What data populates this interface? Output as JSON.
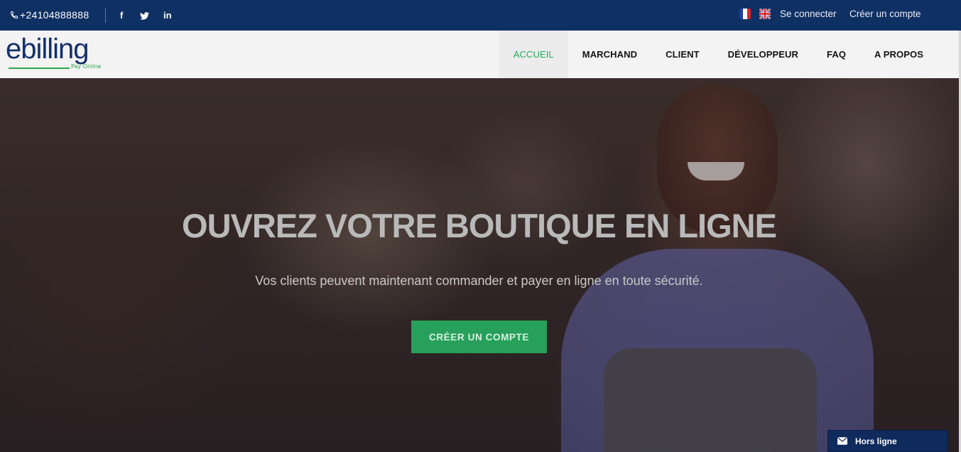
{
  "topbar": {
    "phone": "+24104888888",
    "social": {
      "facebook": "f",
      "twitter": "twitter-icon",
      "linkedin": "in"
    },
    "languages": [
      "fr",
      "en"
    ],
    "login_label": "Se connecter",
    "register_label": "Créer un compte"
  },
  "brand": {
    "logo_text": "ebilling",
    "tagline": "Pay Online",
    "primary_color": "#13306a",
    "accent_color": "#2fa84f"
  },
  "nav": {
    "items": [
      {
        "label": "ACCUEIL",
        "active": true
      },
      {
        "label": "MARCHAND"
      },
      {
        "label": "CLIENT"
      },
      {
        "label": "DÉVELOPPEUR"
      },
      {
        "label": "FAQ"
      },
      {
        "label": "A PROPOS"
      }
    ]
  },
  "hero": {
    "title": "OUVREZ VOTRE BOUTIQUE EN LIGNE",
    "subtitle": "Vos clients peuvent maintenant commander et payer en ligne en toute sécurité.",
    "cta_label": "CRÉER UN COMPTE"
  },
  "chat": {
    "status": "Hors ligne"
  }
}
